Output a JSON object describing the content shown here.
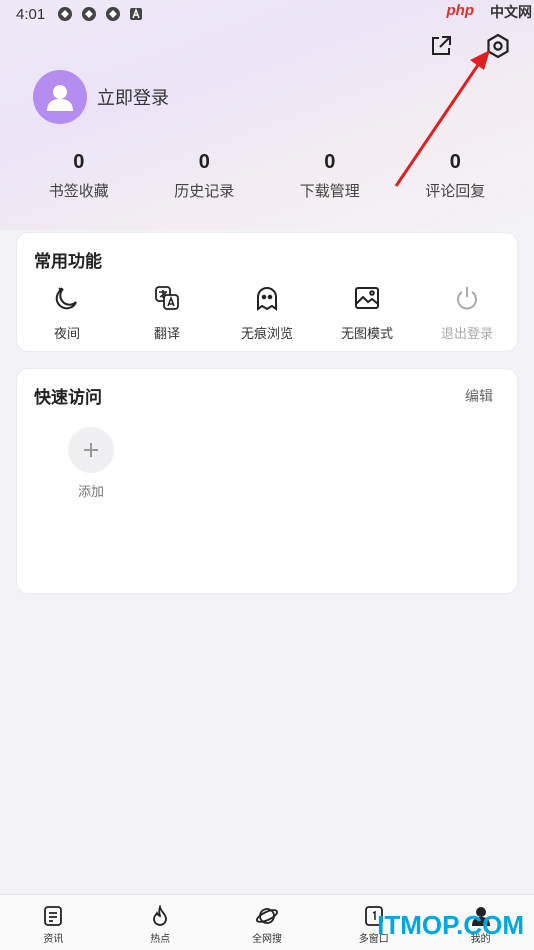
{
  "status_bar": {
    "time": "4:01",
    "watermark_php": "php",
    "watermark_cn": "中文网"
  },
  "header": {
    "share_icon": "share-icon",
    "settings_icon": "gear-icon"
  },
  "profile": {
    "login_label": "立即登录"
  },
  "stats": [
    {
      "value": "0",
      "label": "书签收藏"
    },
    {
      "value": "0",
      "label": "历史记录"
    },
    {
      "value": "0",
      "label": "下载管理"
    },
    {
      "value": "0",
      "label": "评论回复"
    }
  ],
  "common": {
    "title": "常用功能",
    "items": [
      {
        "label": "夜间",
        "icon": "moon-icon"
      },
      {
        "label": "翻译",
        "icon": "translate-icon"
      },
      {
        "label": "无痕浏览",
        "icon": "ghost-icon"
      },
      {
        "label": "无图模式",
        "icon": "image-icon"
      },
      {
        "label": "退出登录",
        "icon": "power-icon"
      }
    ]
  },
  "quick": {
    "title": "快速访问",
    "edit_label": "编辑",
    "add_label": "添加"
  },
  "nav": [
    {
      "label": "资讯",
      "icon": "news-icon"
    },
    {
      "label": "热点",
      "icon": "flame-icon"
    },
    {
      "label": "全网搜",
      "icon": "planet-icon"
    },
    {
      "label": "多窗口",
      "icon": "windows-icon"
    },
    {
      "label": "我的",
      "icon": "user-icon"
    }
  ],
  "watermark_bottom": "ITMOP.COM",
  "colors": {
    "avatar": "#b58df0",
    "annotation_arrow": "#e02020",
    "watermark": "#00a8e0"
  }
}
